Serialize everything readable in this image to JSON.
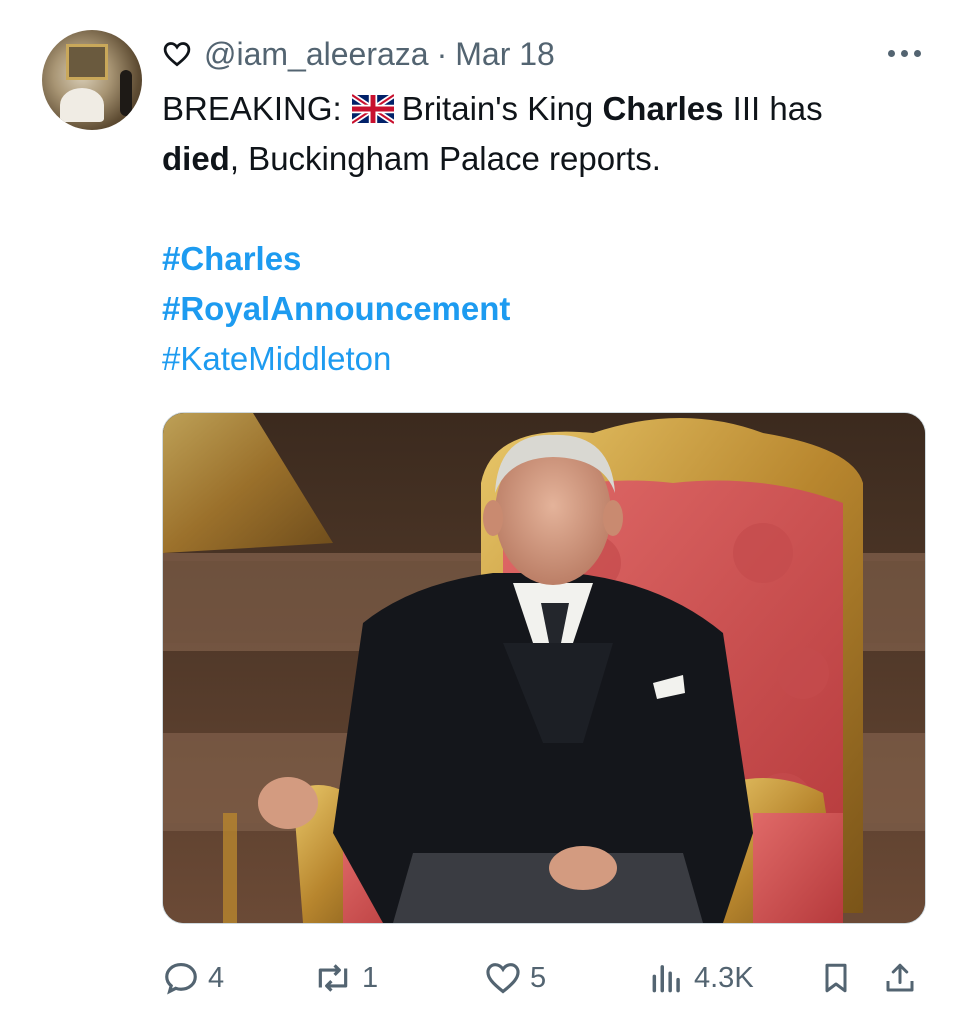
{
  "tweet": {
    "handle": "@iam_aleeraza",
    "separator": "·",
    "date": "Mar 18",
    "text": {
      "prefix": "BREAKING:",
      "before_name": "Britain's King ",
      "name": "Charles",
      "after_name": " III has",
      "died": "died",
      "rest": ", Buckingham Palace reports."
    },
    "hashtags": [
      "#Charles",
      "#RoyalAnnouncement",
      "#KateMiddleton"
    ]
  },
  "actions": {
    "replies": "4",
    "reposts": "1",
    "likes": "5",
    "views": "4.3K"
  },
  "icons": {
    "reply": "speech-bubble-icon",
    "repost": "repost-arrows-icon",
    "like": "heart-icon",
    "views": "bar-chart-icon",
    "bookmark": "bookmark-icon",
    "share": "share-icon",
    "more": "ellipsis-icon"
  },
  "colors": {
    "link": "#1d9bf0",
    "secondary_text": "#536471",
    "primary_text": "#0f1419"
  }
}
